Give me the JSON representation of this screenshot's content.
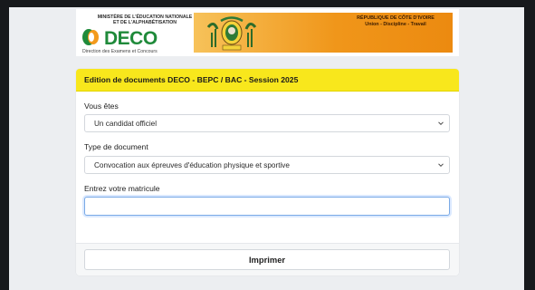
{
  "banner": {
    "ministry_line1": "MINISTÈRE DE L'ÉDUCATION NATIONALE",
    "ministry_line2": "ET DE L'ALPHABÉTISATION",
    "logo_text": "DECO",
    "logo_subtitle": "Direction des Examens et Concours",
    "republic_line1": "RÉPUBLIQUE DE CÔTE D'IVOIRE",
    "republic_line2": "Union - Discipline - Travail",
    "emblem_icon": "coat-of-arms-icon"
  },
  "form": {
    "title": "Edition de documents DECO - BEPC / BAC - Session 2025",
    "candidate_label": "Vous êtes",
    "candidate_value": "Un candidat officiel",
    "doctype_label": "Type de document",
    "doctype_value": "Convocation aux épreuves d'éducation physique et sportive",
    "matricule_label": "Entrez votre matricule",
    "matricule_value": "",
    "print_label": "Imprimer"
  },
  "colors": {
    "header_yellow": "#f8e71c",
    "deco_green": "#1f8a3a",
    "banner_orange": "#f0961a",
    "focus_border": "#7aaae6"
  }
}
